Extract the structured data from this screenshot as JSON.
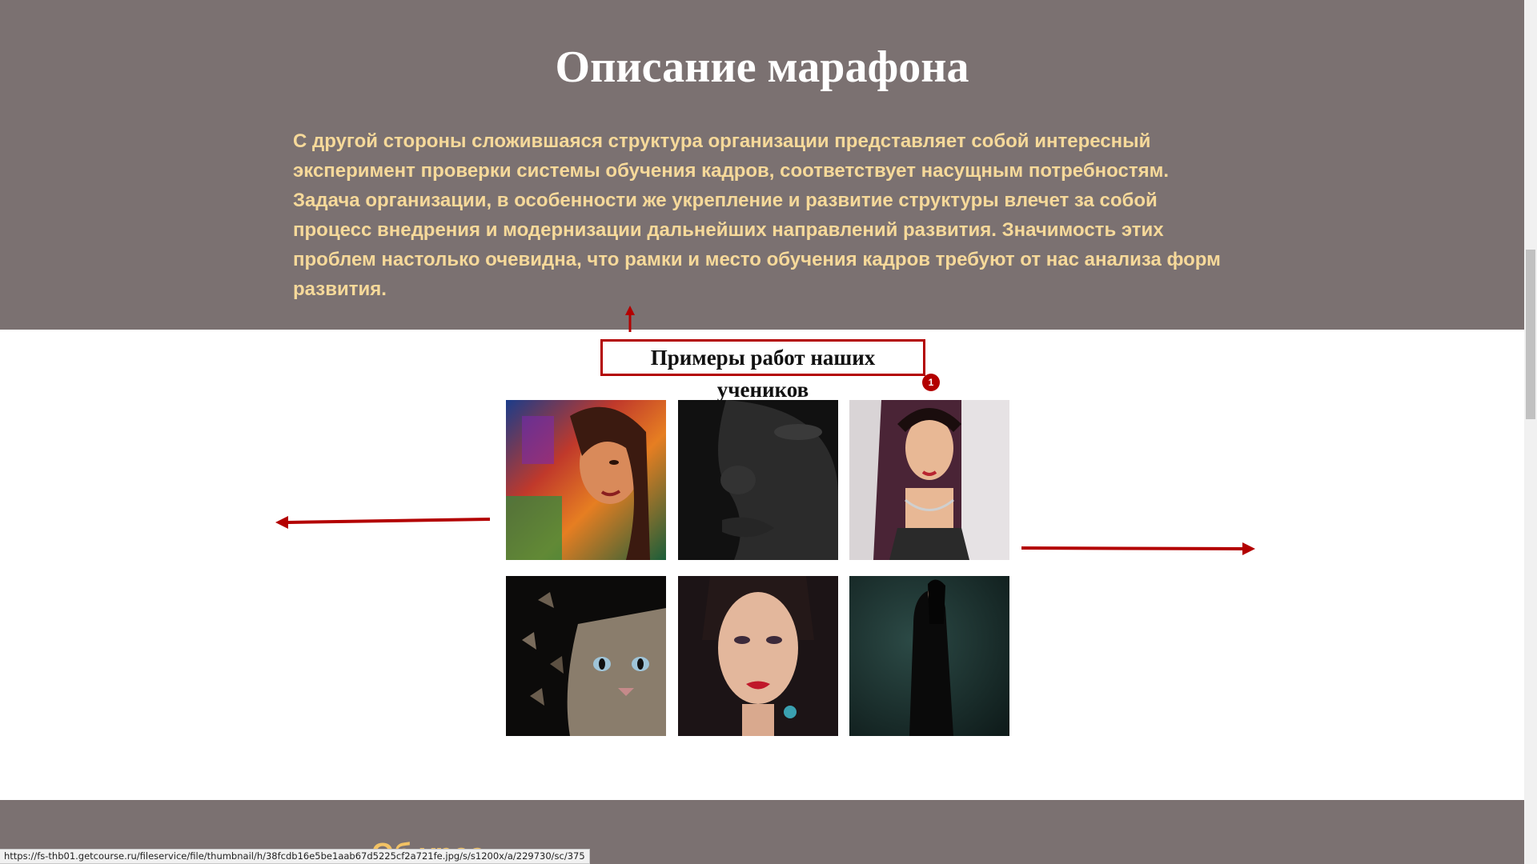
{
  "description": {
    "title": "Описание марафона",
    "paragraph1": "С другой стороны сложившаяся структура организации представляет собой интересный эксперимент проверки системы обучения кадров, соответствует насущным потребностям.",
    "paragraph2": "Задача организации, в особенности же укрепление и развитие структуры влечет за собой процесс внедрения и модернизации дальнейших направлений развития. Значимость этих проблем настолько очевидна, что рамки и место обучения кадров требуют от нас анализа форм развития.",
    "background_color": "#7b7171",
    "text_color": "#f6d99a"
  },
  "gallery": {
    "title": "Примеры работ наших учеников",
    "badge": "1",
    "images": [
      {
        "name": "colorful-portrait-woman"
      },
      {
        "name": "dark-skin-face-closeup"
      },
      {
        "name": "asian-woman-with-jewelry"
      },
      {
        "name": "dispersion-cat"
      },
      {
        "name": "makeup-portrait-woman"
      },
      {
        "name": "woman-in-black-dress"
      }
    ]
  },
  "next_section": {
    "title_partial": "Об          урса"
  },
  "status_bar": {
    "url": "https://fs-thb01.getcourse.ru/fileservice/file/thumbnail/h/38fcdb16e5be1aab67d5225cf2a721fe.jpg/s/s1200x/a/229730/sc/375"
  },
  "annotation_color": "#b30000"
}
